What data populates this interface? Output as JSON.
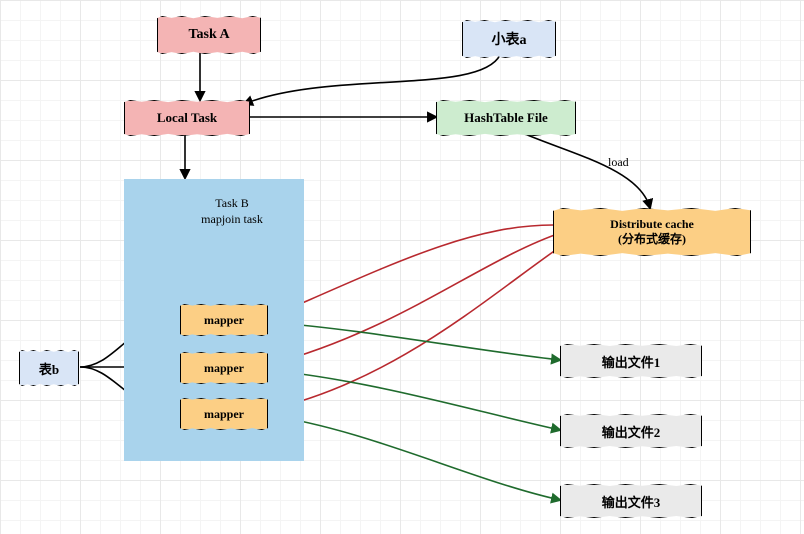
{
  "nodes": {
    "taskA": {
      "label": "Task A"
    },
    "smallTable": {
      "label": "小表a"
    },
    "localTask": {
      "label": "Local Task"
    },
    "hashTable": {
      "label": "HashTable File"
    },
    "distCache": {
      "label": "Distribute cache\n(分布式缓存)"
    },
    "taskB": {
      "label": "Task B\nmapjoin task"
    },
    "mapper1": {
      "label": "mapper"
    },
    "mapper2": {
      "label": "mapper"
    },
    "mapper3": {
      "label": "mapper"
    },
    "tableB": {
      "label": "表b"
    },
    "out1": {
      "label": "输出文件1"
    },
    "out2": {
      "label": "输出文件2"
    },
    "out3": {
      "label": "输出文件3"
    }
  },
  "edgeLabels": {
    "load": "load"
  },
  "colors": {
    "red": "#f4b4b4",
    "blueBg": "#a9d3ec",
    "blueLt": "#d9e5f6",
    "green": "#cdeccf",
    "orange": "#fccf85",
    "grey": "#eaeaea",
    "arrowBlack": "#000000",
    "arrowRed": "#b8292f",
    "arrowGreen": "#1f6b2d"
  }
}
